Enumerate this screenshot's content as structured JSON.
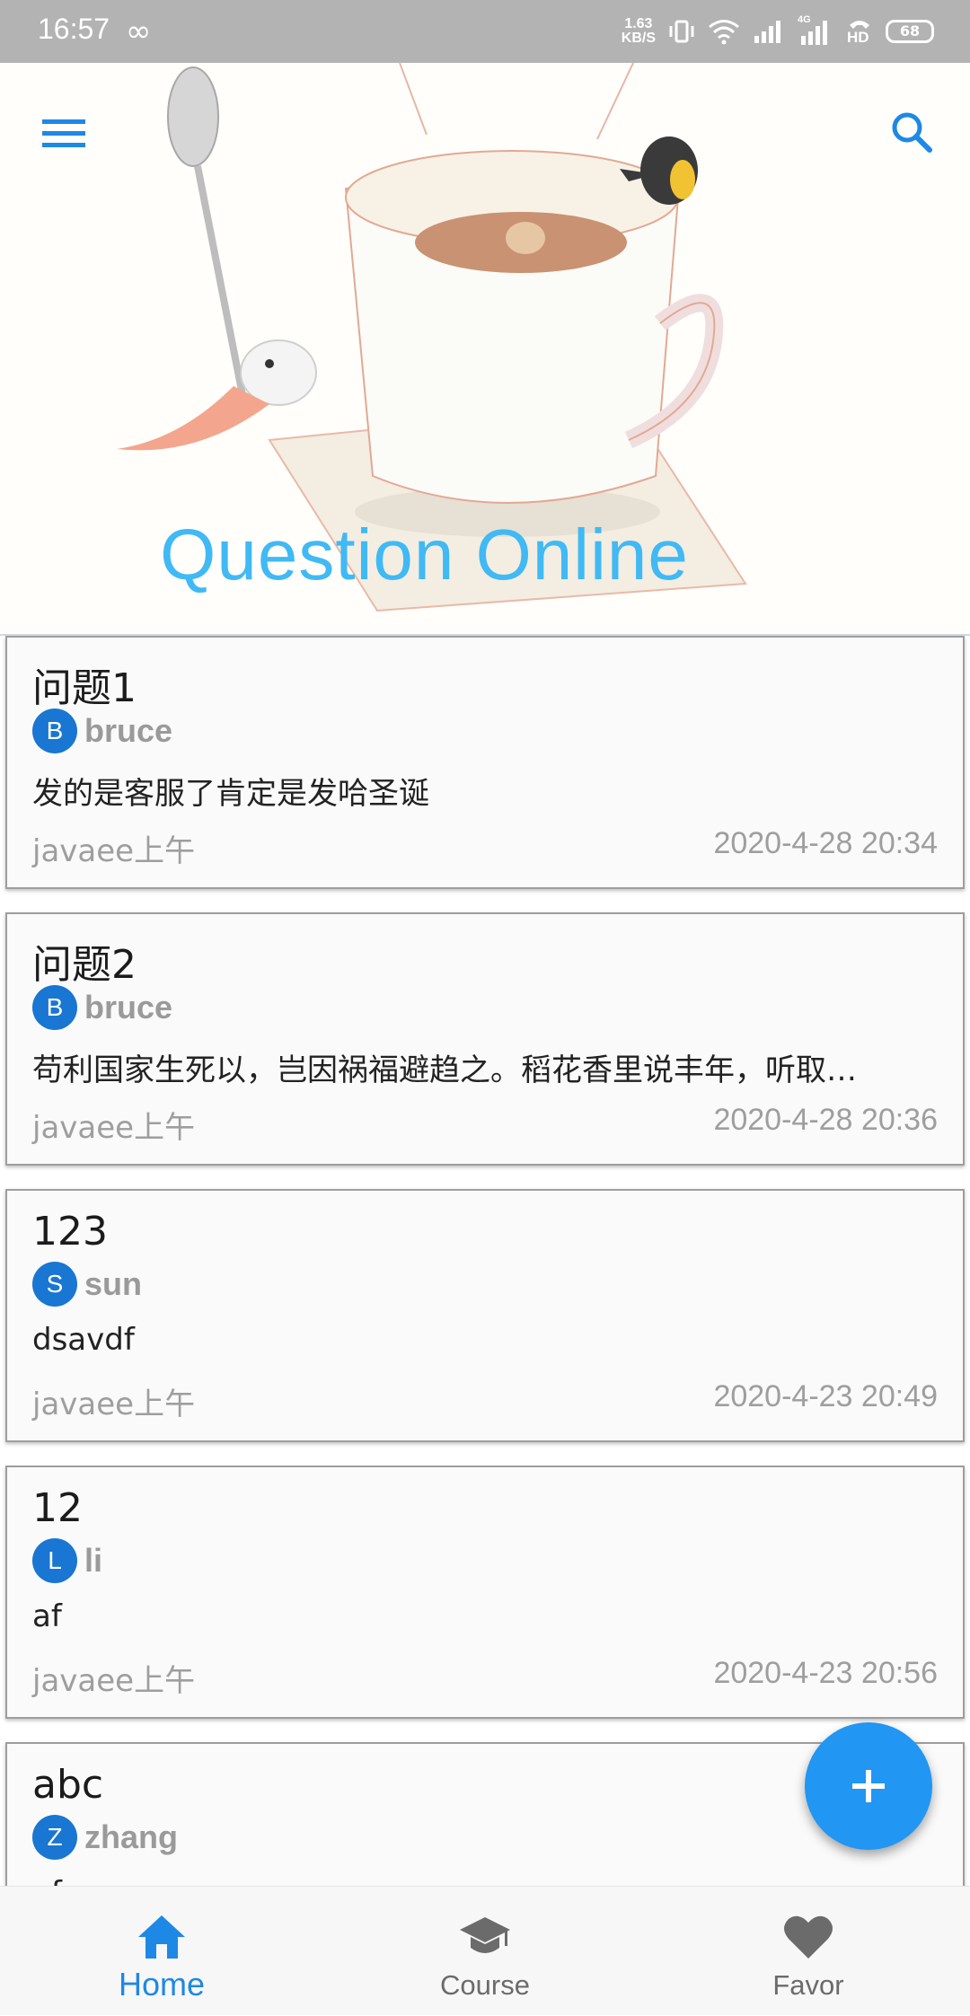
{
  "status_bar": {
    "time": "16:57",
    "link_icon": "∞",
    "net_speed_value": "1.63",
    "net_speed_unit": "KB/S",
    "network_type": "4G",
    "hd_label": "HD",
    "battery_level": "68"
  },
  "header": {
    "title": "Question Online",
    "menu_icon": "menu-icon",
    "search_icon": "search-icon",
    "title_color": "#40b9f4"
  },
  "questions": [
    {
      "title": "问题1",
      "avatar_letter": "B",
      "author": "bruce",
      "body": "发的是客服了肯定是发哈圣诞",
      "course": "javaee上午",
      "time": "2020-4-28 20:34"
    },
    {
      "title": "问题2",
      "avatar_letter": "B",
      "author": "bruce",
      "body": "苟利国家生死以，岂因祸福避趋之。稻花香里说丰年，听取…",
      "course": "javaee上午",
      "time": "2020-4-28 20:36"
    },
    {
      "title": "123",
      "avatar_letter": "S",
      "author": "sun",
      "body": "dsavdf",
      "course": "javaee上午",
      "time": "2020-4-23 20:49"
    },
    {
      "title": "12",
      "avatar_letter": "L",
      "author": "li",
      "body": "af",
      "course": "javaee上午",
      "time": "2020-4-23 20:56"
    },
    {
      "title": "abc",
      "avatar_letter": "Z",
      "author": "zhang",
      "body": "af",
      "course": "",
      "time": ""
    }
  ],
  "fab": {
    "icon": "plus-icon",
    "color": "#2196f3"
  },
  "bottom_nav": {
    "items": [
      {
        "label": "Home",
        "icon": "home-icon",
        "active": true
      },
      {
        "label": "Course",
        "icon": "graduation-cap-icon",
        "active": false
      },
      {
        "label": "Favor",
        "icon": "heart-icon",
        "active": false
      }
    ],
    "active_color": "#1e88e5"
  }
}
